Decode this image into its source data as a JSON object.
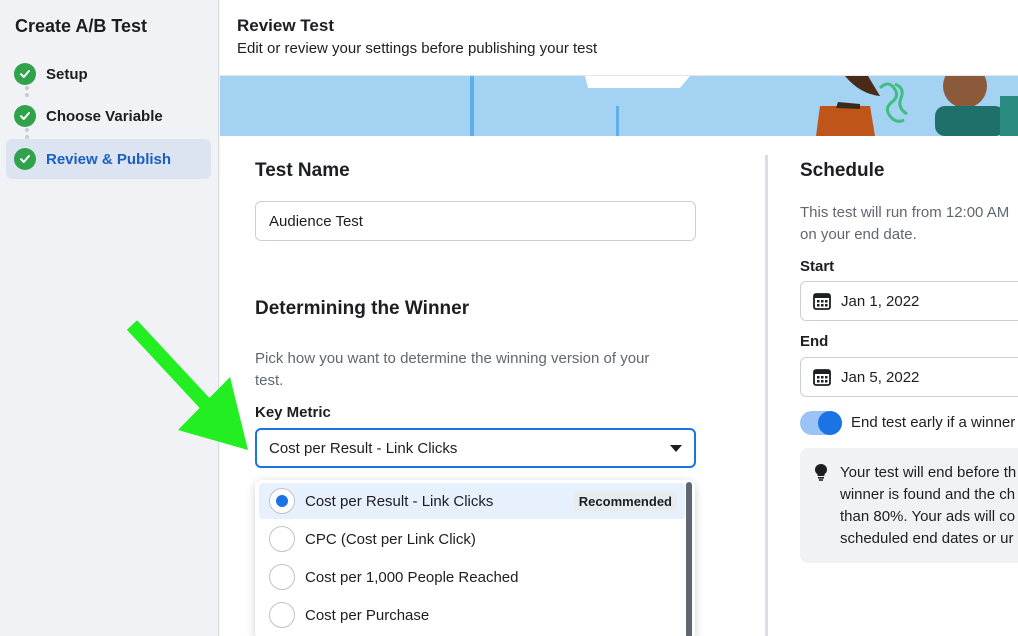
{
  "sidebar": {
    "title": "Create A/B Test",
    "steps": [
      {
        "label": "Setup"
      },
      {
        "label": "Choose Variable"
      },
      {
        "label": "Review & Publish"
      }
    ]
  },
  "header": {
    "title": "Review Test",
    "subtitle": "Edit or review your settings before publishing your test"
  },
  "test_name": {
    "heading": "Test Name",
    "value": "Audience Test"
  },
  "winner": {
    "heading": "Determining the Winner",
    "description_line1": "Pick how you want to determine the winning version of your",
    "description_line2": "test.",
    "key_metric_label": "Key Metric",
    "selected_value": "Cost per Result - Link Clicks",
    "options": [
      {
        "label": "Cost per Result - Link Clicks",
        "badge": "Recommended",
        "selected": true
      },
      {
        "label": "CPC (Cost per Link Click)",
        "selected": false
      },
      {
        "label": "Cost per 1,000 People Reached",
        "selected": false
      },
      {
        "label": "Cost per Purchase",
        "selected": false
      }
    ]
  },
  "schedule": {
    "heading": "Schedule",
    "description_line1": "This test will run from 12:00 AM",
    "description_line2": "on your end date.",
    "start_label": "Start",
    "start_value": "Jan 1, 2022",
    "end_label": "End",
    "end_value": "Jan 5, 2022",
    "toggle_label": "End test early if a winner",
    "toggle_on": true,
    "info_lines": [
      "Your test will end before th",
      "winner is found and the ch",
      "than 80%. Your ads will co",
      "scheduled end dates or ur"
    ]
  },
  "colors": {
    "accent": "#1b74e4",
    "success": "#31a24c",
    "arrow": "#22ee22",
    "banner": "#a3d2f2"
  }
}
